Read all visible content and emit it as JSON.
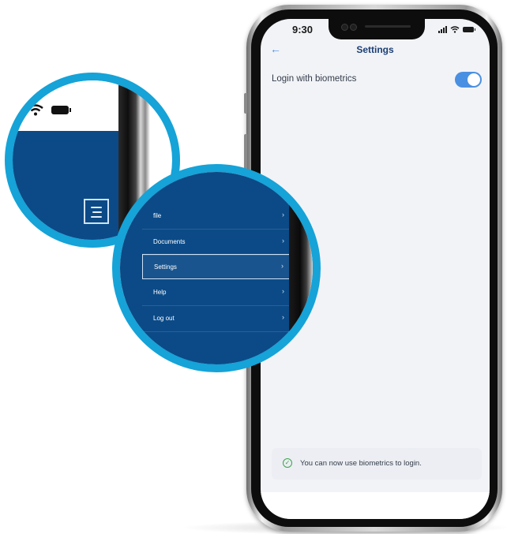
{
  "status_bar": {
    "time": "9:30"
  },
  "settings_screen": {
    "title": "Settings",
    "back_icon": "back-arrow-icon",
    "back_glyph": "←",
    "biometrics_label": "Login with biometrics",
    "biometrics_enabled": true,
    "toast": {
      "icon": "check-circle-icon",
      "icon_glyph": "✓",
      "text": "You can now use biometrics to login."
    }
  },
  "menu_zoom": {
    "menu_icon": "hamburger-menu-icon",
    "items": [
      {
        "label": "file",
        "chevron": "›"
      },
      {
        "label": "Documents",
        "chevron": "›"
      },
      {
        "label": "Settings",
        "chevron": "›",
        "active": true
      },
      {
        "label": "Help",
        "chevron": "›"
      },
      {
        "label": "Log out",
        "chevron": "›"
      }
    ]
  },
  "colors": {
    "accent": "#4a90e2",
    "menu_bg": "#0b4a87",
    "magnifier_ring": "#15a3d8",
    "screen_bg": "#f2f3f7",
    "title_text": "#1b3f74",
    "success": "#3fa34d"
  }
}
